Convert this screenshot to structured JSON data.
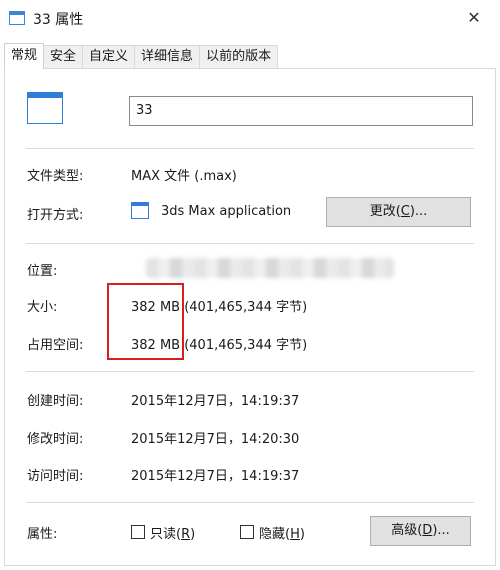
{
  "window": {
    "title": "33 属性",
    "close_glyph": "✕"
  },
  "tabs": [
    {
      "label": "常规",
      "active": true
    },
    {
      "label": "安全"
    },
    {
      "label": "自定义"
    },
    {
      "label": "详细信息"
    },
    {
      "label": "以前的版本"
    }
  ],
  "general": {
    "file_name": "33",
    "file_type": {
      "label": "文件类型:",
      "value": "MAX 文件 (.max)"
    },
    "open_with": {
      "label": "打开方式:",
      "value": "3ds Max application",
      "button_prefix": "更改(",
      "button_key": "C",
      "button_suffix": ")..."
    },
    "location": {
      "label": "位置:"
    },
    "size": {
      "label": "大小:",
      "value": "382 MB (401,465,344 字节)"
    },
    "size_on_disk": {
      "label": "占用空间:",
      "value": "382 MB (401,465,344 字节)"
    },
    "created": {
      "label": "创建时间:",
      "value": "2015年12月7日，14:19:37"
    },
    "modified": {
      "label": "修改时间:",
      "value": "2015年12月7日，14:20:30"
    },
    "accessed": {
      "label": "访问时间:",
      "value": "2015年12月7日，14:19:37"
    },
    "attributes": {
      "label": "属性:",
      "readonly_prefix": "只读(",
      "readonly_key": "R",
      "readonly_suffix": ")",
      "hidden_prefix": "隐藏(",
      "hidden_key": "H",
      "hidden_suffix": ")",
      "advanced_prefix": "高级(",
      "advanced_key": "D",
      "advanced_suffix": ")..."
    }
  },
  "colors": {
    "accent": "#2f7ed8",
    "highlight_box": "#d81e1e"
  }
}
